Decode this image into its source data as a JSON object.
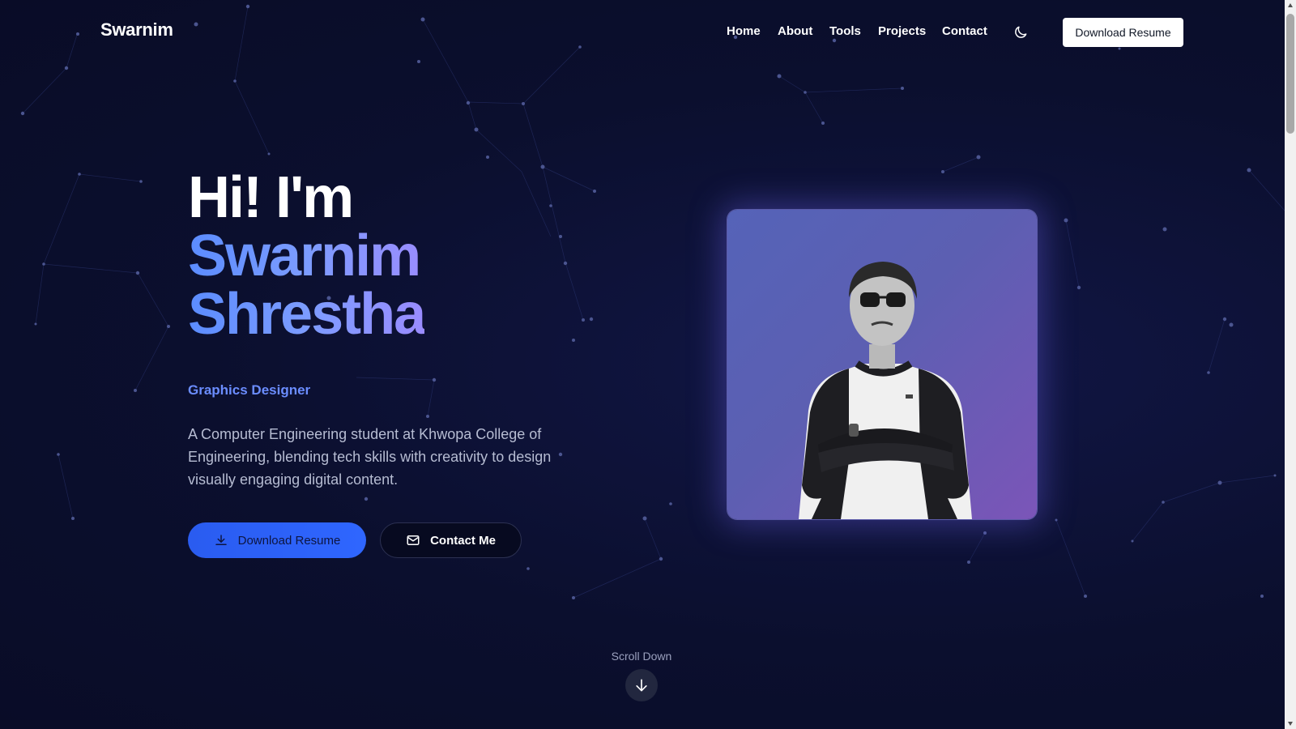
{
  "header": {
    "logo": "Swarnim",
    "nav": [
      {
        "label": "Home"
      },
      {
        "label": "About"
      },
      {
        "label": "Tools"
      },
      {
        "label": "Projects"
      },
      {
        "label": "Contact"
      }
    ],
    "theme_icon": "moon-icon",
    "resume_label": "Download Resume"
  },
  "hero": {
    "greeting": "Hi! I'm",
    "first_name": "Swarnim",
    "last_name": "Shrestha",
    "role": "Graphics Designer",
    "description": "A Computer Engineering student at Khwopa College of Engineering, blending tech skills with creativity to design visually engaging digital content.",
    "primary_button": "Download Resume",
    "primary_icon": "download-icon",
    "secondary_button": "Contact Me",
    "secondary_icon": "mail-icon"
  },
  "scroll": {
    "label": "Scroll Down",
    "icon": "arrow-down-icon"
  },
  "colors": {
    "background": "#0b0f2e",
    "accent": "#2f66ff",
    "name_gradient_start": "#5b8cff",
    "name_gradient_end": "#9a8cff",
    "role": "#6b8dff"
  }
}
